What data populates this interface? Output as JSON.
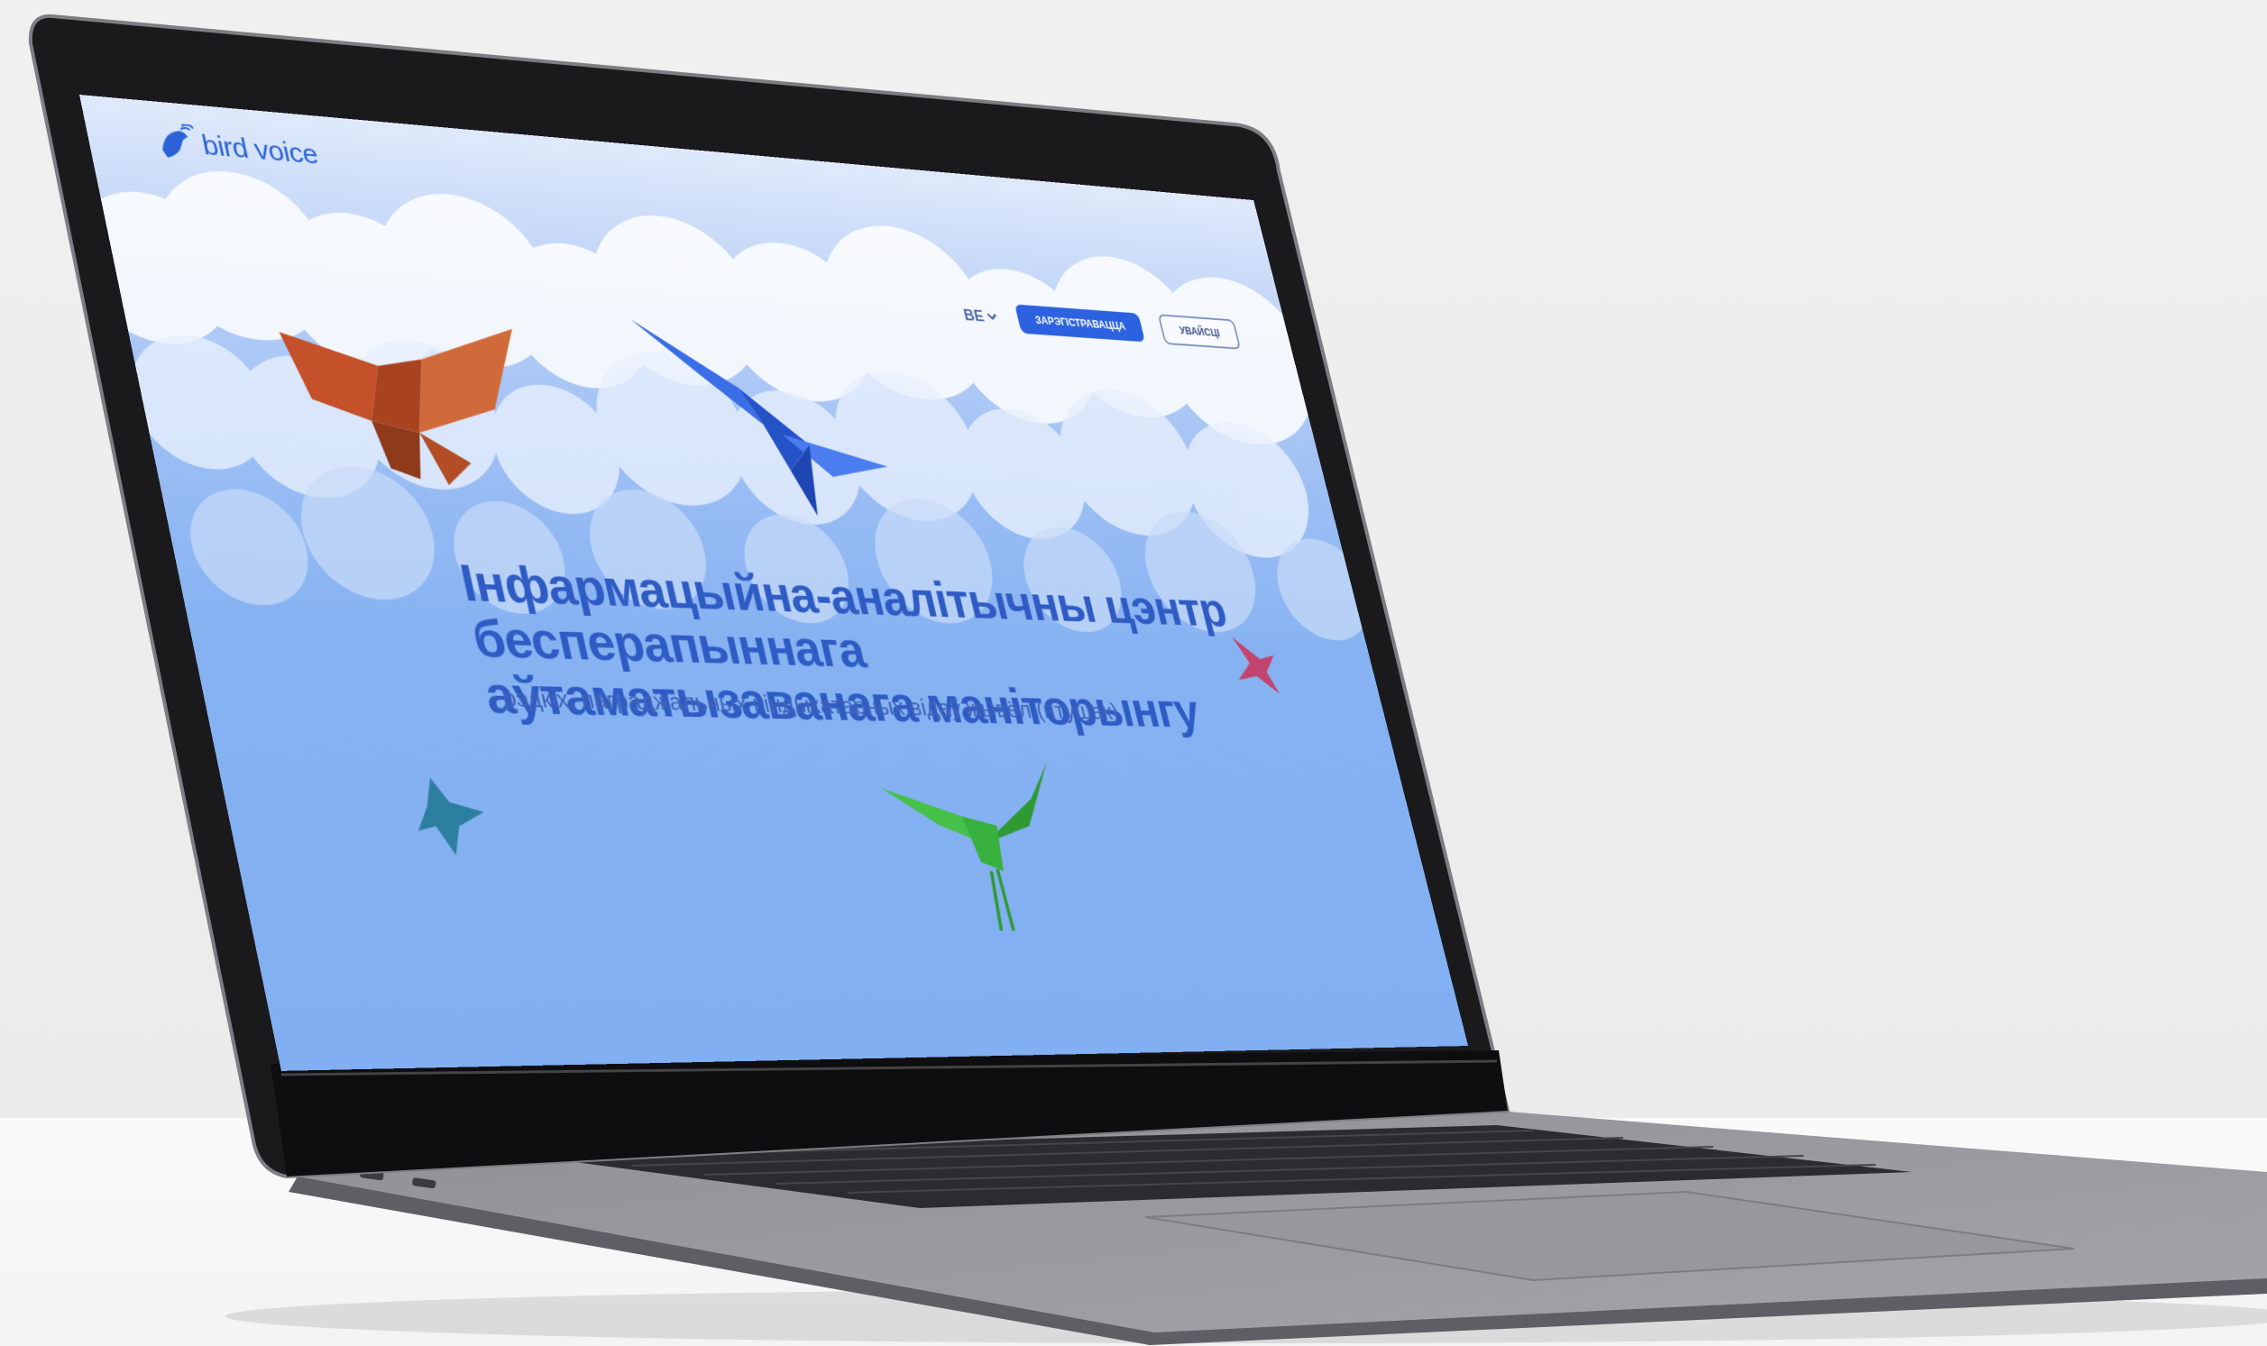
{
  "site": {
    "logo_text": "bird voice",
    "nav": {
      "language": "BE",
      "register_button": "ЗАРЭГІСТРАВАЦЦА",
      "login_button": "УВАЙСЦІ"
    },
    "hero": {
      "title_line1": "Інфармацыйна-аналітычны цэнтр бесперапыннага",
      "title_line2": "аўтаматызаванага маніторынгу",
      "subtitle": "рэдкіх, паграджальных і індыкатарных відаў жывёл (птушак)"
    }
  },
  "colors": {
    "accent": "#2c62e0",
    "sky": "#82aff2",
    "title": "#2f5cc4"
  },
  "icons": [
    "bird-logo-icon",
    "chevron-down-icon"
  ]
}
